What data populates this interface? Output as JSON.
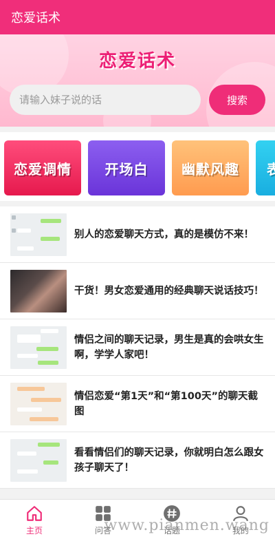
{
  "app": {
    "title": "恋爱话术"
  },
  "hero": {
    "title": "恋爱话术",
    "search_placeholder": "请输入妹子说的话",
    "search_button": "搜索"
  },
  "categories": [
    {
      "label": "恋爱调情"
    },
    {
      "label": "开场白"
    },
    {
      "label": "幽默风趣"
    },
    {
      "label": "表"
    }
  ],
  "articles": [
    {
      "title": "别人的恋爱聊天方式，真的是模仿不来！"
    },
    {
      "title": "干货！男女恋爱通用的经典聊天说话技巧！"
    },
    {
      "title": "情侣之间的聊天记录，男生是真的会哄女生啊，学学人家吧！"
    },
    {
      "title": "情侣恋爱“第1天”和“第100天”的聊天截图"
    },
    {
      "title": "看看情侣们的聊天记录，你就明白怎么跟女孩子聊天了！"
    }
  ],
  "nav": [
    {
      "label": "主页",
      "icon": "home-icon",
      "active": true
    },
    {
      "label": "问答",
      "icon": "grid-icon"
    },
    {
      "label": "话题",
      "icon": "hashtag-icon"
    },
    {
      "label": "我的",
      "icon": "user-icon"
    }
  ],
  "watermark": "www.pianmen.wang",
  "colors": {
    "accent": "#ef2d78",
    "appbar": "#f02e7a",
    "hero_title": "#ec1e74"
  }
}
